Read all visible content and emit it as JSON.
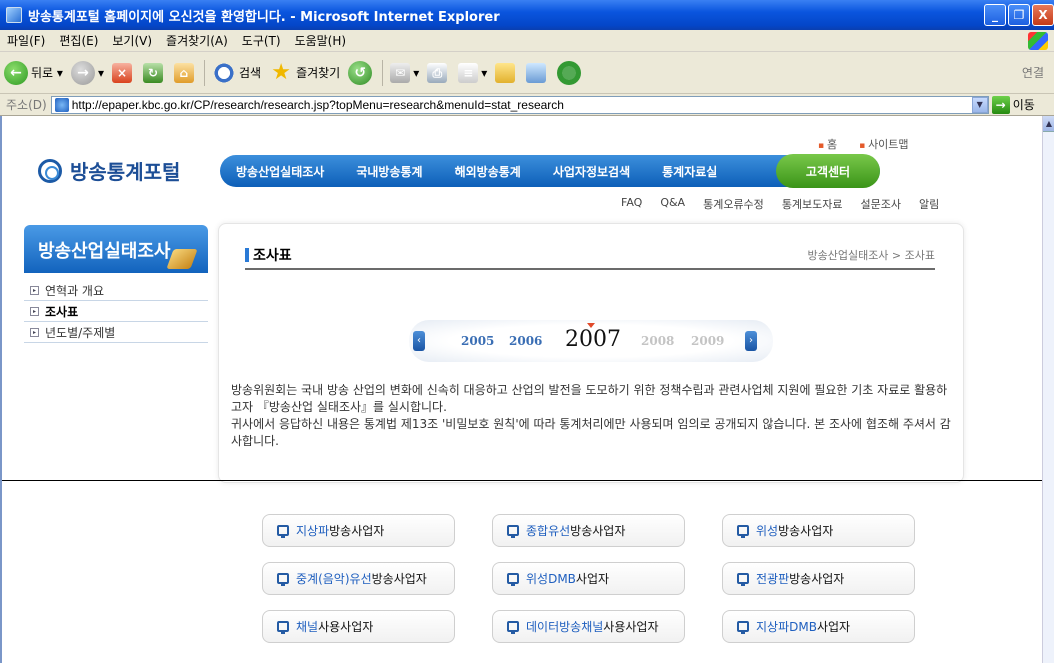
{
  "window": {
    "title": "방송통계포털 홈페이지에 오신것을 환영합니다. - Microsoft Internet Explorer",
    "buttons": [
      "_",
      "❐",
      "X"
    ]
  },
  "menu": [
    "파일(F)",
    "편집(E)",
    "보기(V)",
    "즐겨찾기(A)",
    "도구(T)",
    "도움말(H)"
  ],
  "toolbar": {
    "back": "뒤로",
    "search": "검색",
    "favorites": "즐겨찾기",
    "links": "연결"
  },
  "address": {
    "label": "주소(D)",
    "url": "http://epaper.kbc.go.kr/CP/research/research.jsp?topMenu=research&menuId=stat_research",
    "go": "이동"
  },
  "site": {
    "top_links": [
      "홈",
      "사이트맵"
    ],
    "logo": "방송통계포털",
    "gnb": [
      "방송산업실태조사",
      "국내방송통계",
      "해외방송통계",
      "사업자정보검색",
      "통계자료실"
    ],
    "gnb_highlight": "고객센터",
    "subnav": [
      "FAQ",
      "Q&A",
      "통계오류수정",
      "통계보도자료",
      "설문조사",
      "알림"
    ]
  },
  "left": {
    "heading": "방송산업실태조사",
    "items": [
      "연혁과 개요",
      "조사표",
      "년도별/주제별"
    ]
  },
  "content": {
    "title": "조사표",
    "breadcrumb": "방송산업실태조사 > 조사표",
    "years": [
      "2005",
      "2006",
      "2007",
      "2008",
      "2009"
    ],
    "selected_year": "2007",
    "intro_1": "방송위원회는 국내 방송 산업의 변화에 신속히 대응하고 산업의 발전을 도모하기 위한 정책수립과 관련사업체 지원에 필요한 기초 자료로 활용하고자 『방송산업 실태조사』를 실시합니다.",
    "intro_2": "귀사에서 응답하신 내용은 통계법 제13조 '비밀보호 원칙'에 따라 통계처리에만 사용되며 임의로 공개되지 않습니다. 본 조사에 협조해 주셔서 감사합니다."
  },
  "operators": [
    {
      "blue": "지상파",
      "black": "방송사업자"
    },
    {
      "blue": "종합유선",
      "black": "방송사업자"
    },
    {
      "blue": "위성",
      "black": "방송사업자"
    },
    {
      "blue": "중계(음악)유선",
      "black": "방송사업자"
    },
    {
      "blue": "위성DMB",
      "black": "사업자"
    },
    {
      "blue": "전광판",
      "black": "방송사업자"
    },
    {
      "blue": "채널",
      "black": "사용사업자"
    },
    {
      "blue": "데이터방송채널",
      "black": "사용사업자"
    },
    {
      "blue": "지상파DMB",
      "black": "사업자"
    }
  ]
}
